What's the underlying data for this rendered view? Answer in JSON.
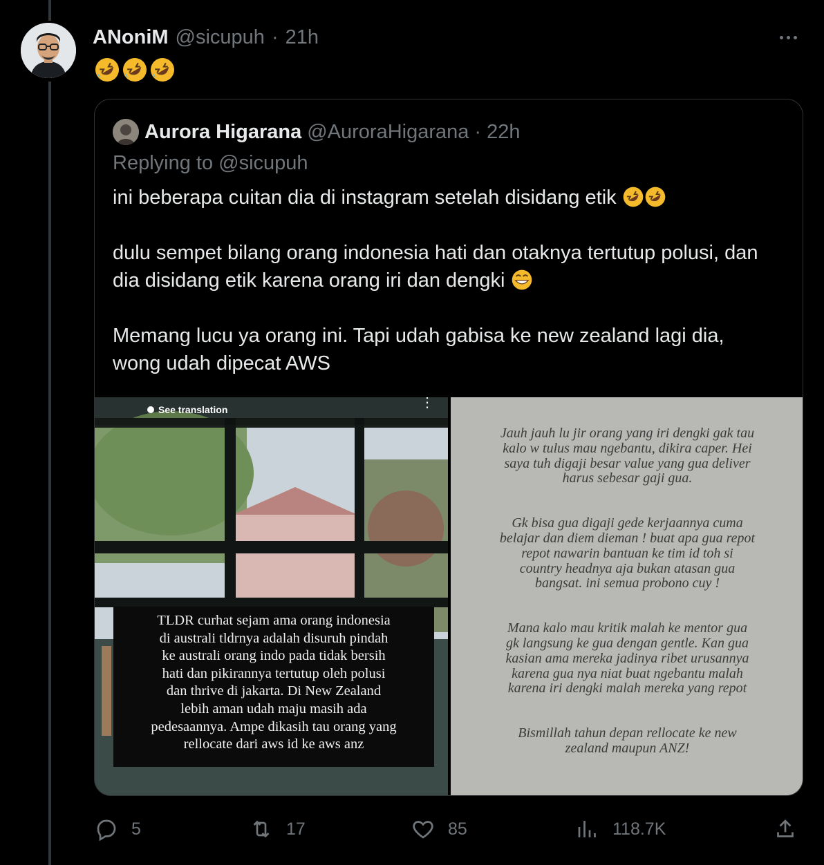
{
  "tweet": {
    "display_name": "ANoniM",
    "handle": "@sicupuh",
    "separator": "·",
    "time": "21h",
    "emoji_text": "🤣🤣🤣"
  },
  "quote": {
    "display_name": "Aurora Higarana",
    "handle": "@AuroraHigarana",
    "separator": "·",
    "time": "22h",
    "replying_to": "Replying to @sicupuh",
    "paragraph1": "ini beberapa cuitan dia di instagram setelah disidang etik",
    "paragraph2": "dulu sempet bilang orang indonesia hati dan otaknya tertutup polusi, dan dia disidang etik karena orang iri dan dengki",
    "paragraph3": "Memang lucu ya orang ini. Tapi udah gabisa ke new zealand lagi dia, wong udah dipecat AWS"
  },
  "media": {
    "left_see_translation": "See translation",
    "left_overlay": "TLDR curhat sejam  ama orang indonesia\ndi australi tldrnya adalah disuruh pindah\nke australi orang indo pada tidak bersih\nhati dan pikirannya tertutup oleh polusi\ndan thrive di jakarta. Di New Zealand\nlebih aman udah maju masih ada\npedesaannya. Ampe dikasih tau orang yang\nrellocate dari aws id ke aws anz",
    "right_para1": "Jauh jauh lu jir orang yang iri dengki gak tau\nkalo w tulus mau ngebantu, dikira caper. Hei\nsaya tuh digaji besar value yang gua deliver\nharus sebesar gaji gua.",
    "right_para2": "Gk bisa gua digaji gede kerjaannya cuma\nbelajar dan diem dieman ! buat apa gua repot\nrepot nawarin bantuan ke tim id toh si\ncountry headnya aja bukan atasan gua\nbangsat. ini semua probono cuy !",
    "right_para3": "Mana kalo mau kritik malah ke mentor gua\ngk langsung ke gua dengan gentle. Kan gua\nkasian ama mereka jadinya ribet urusannya\nkarena gua nya niat buat ngebantu malah\nkarena iri dengki malah mereka yang repot",
    "right_para4": "Bismillah tahun depan rellocate ke new\nzealand maupun ANZ!"
  },
  "actions": {
    "replies": "5",
    "reposts": "17",
    "likes": "85",
    "views": "118.7K"
  },
  "icons": [
    "reply-icon",
    "repost-icon",
    "like-icon",
    "views-icon",
    "share-icon",
    "more-icon"
  ],
  "colors": {
    "background": "#000000",
    "text": "#e7e9ea",
    "muted": "#71767b",
    "border": "#2f3336"
  }
}
